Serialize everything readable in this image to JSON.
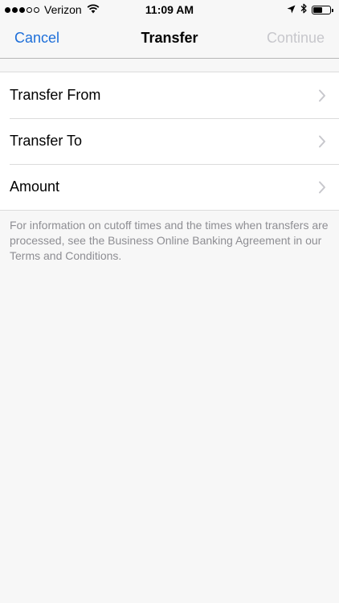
{
  "status_bar": {
    "signal_filled": 3,
    "signal_total": 5,
    "carrier": "Verizon",
    "time": "11:09 AM",
    "battery_level_percent": 55,
    "icons": [
      "wifi-icon",
      "location-arrow-icon",
      "bluetooth-icon",
      "battery-icon"
    ]
  },
  "nav": {
    "cancel_label": "Cancel",
    "title": "Transfer",
    "continue_label": "Continue"
  },
  "rows": [
    {
      "label": "Transfer From"
    },
    {
      "label": "Transfer To"
    },
    {
      "label": "Amount"
    }
  ],
  "footer_note": "For information on cutoff times and the times when transfers are processed, see the Business Online Banking Agreement in our Terms and Conditions.",
  "colors": {
    "accent": "#1e6fd9",
    "disabled": "#c7c7cc",
    "background": "#f7f7f7",
    "footnote": "#8e8e93"
  }
}
